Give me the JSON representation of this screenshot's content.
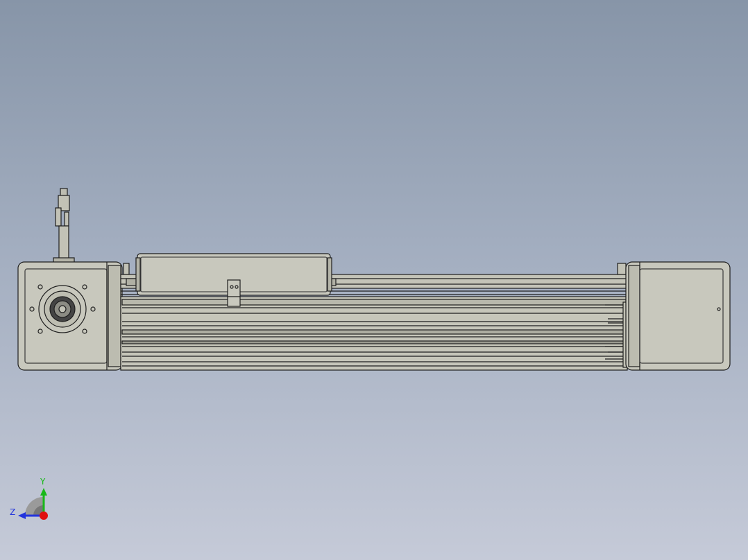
{
  "colors": {
    "background_top": "#8795a8",
    "background_bottom": "#c5cad8",
    "part_fill": "#c2c2b6",
    "part_edge": "#1e1e1e",
    "axis_y": "#18b818",
    "axis_z": "#2233dd",
    "axis_origin": "#e01010"
  },
  "triad": {
    "y_label": "Y",
    "z_label": "Z"
  }
}
